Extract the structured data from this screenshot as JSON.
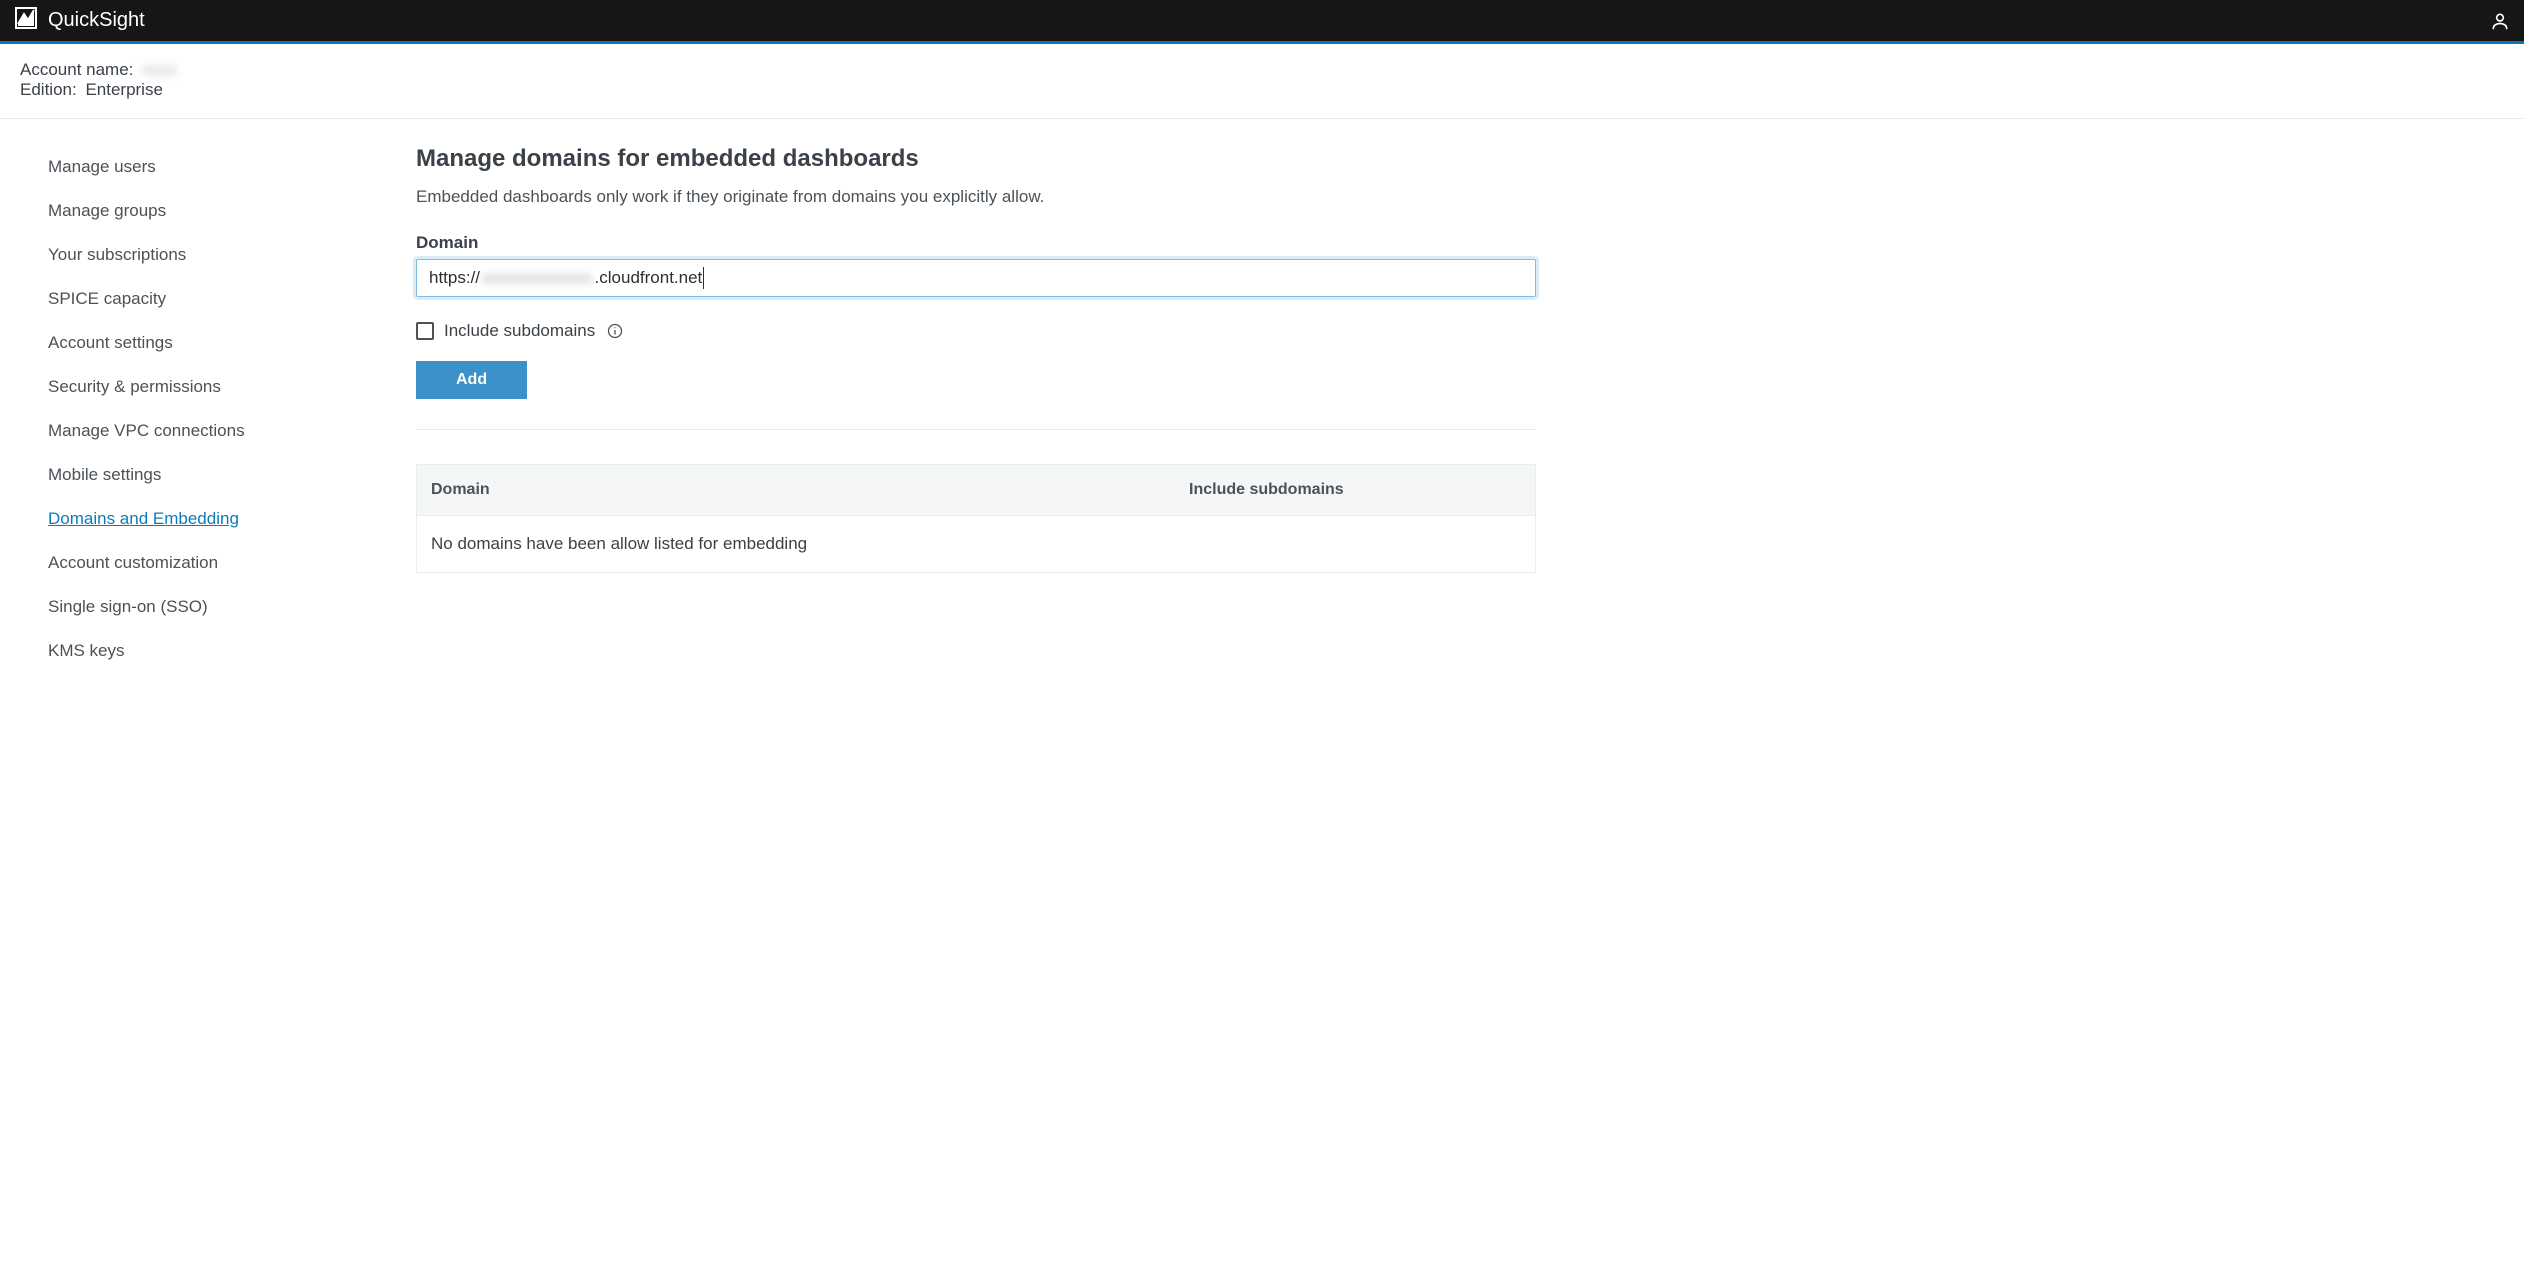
{
  "brand": "QuickSight",
  "account": {
    "name_label": "Account name:",
    "name_value": "xxxx",
    "edition_label": "Edition:",
    "edition_value": "Enterprise"
  },
  "sidebar": {
    "items": [
      {
        "label": "Manage users",
        "active": false
      },
      {
        "label": "Manage groups",
        "active": false
      },
      {
        "label": "Your subscriptions",
        "active": false
      },
      {
        "label": "SPICE capacity",
        "active": false
      },
      {
        "label": "Account settings",
        "active": false
      },
      {
        "label": "Security & permissions",
        "active": false
      },
      {
        "label": "Manage VPC connections",
        "active": false
      },
      {
        "label": "Mobile settings",
        "active": false
      },
      {
        "label": "Domains and Embedding",
        "active": true
      },
      {
        "label": "Account customization",
        "active": false
      },
      {
        "label": "Single sign-on (SSO)",
        "active": false
      },
      {
        "label": "KMS keys",
        "active": false
      }
    ]
  },
  "main": {
    "title": "Manage domains for embedded dashboards",
    "subtitle": "Embedded dashboards only work if they originate from domains you explicitly allow.",
    "domain_field_label": "Domain",
    "domain_input": {
      "prefix": "https://",
      "redacted": "xxxxxxxxxxxxx",
      "suffix": ".cloudfront.net"
    },
    "include_subdomains_label": "Include subdomains",
    "include_subdomains_checked": false,
    "add_button_label": "Add",
    "table": {
      "col_domain": "Domain",
      "col_sub": "Include subdomains",
      "empty_message": "No domains have been allow listed for embedding"
    }
  }
}
